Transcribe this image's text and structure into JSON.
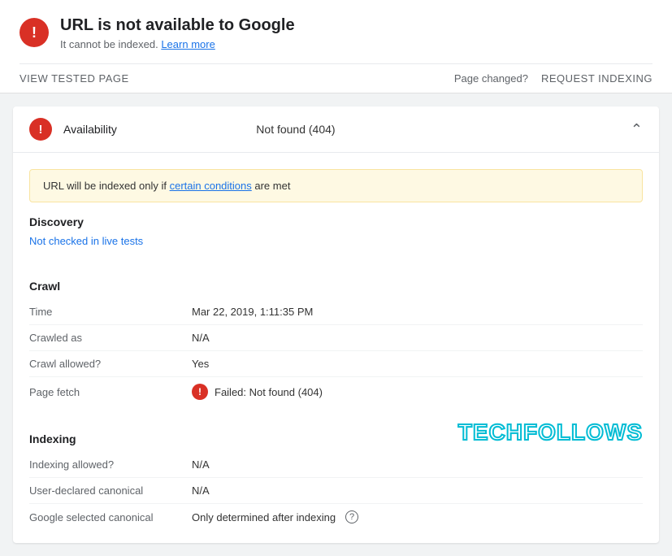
{
  "header": {
    "title": "URL is not available to Google",
    "subtitle": "It cannot be indexed.",
    "learn_more_label": "Learn more",
    "view_tested_page_label": "VIEW TESTED PAGE",
    "page_changed_label": "Page changed?",
    "request_indexing_label": "REQUEST INDEXING"
  },
  "availability": {
    "label": "Availability",
    "status": "Not found (404)",
    "icon": "!"
  },
  "warning": {
    "text": "URL will be indexed only if ",
    "link_text": "certain conditions",
    "text2": " are met"
  },
  "discovery": {
    "section_title": "Discovery",
    "not_checked_label": "Not checked in live tests"
  },
  "crawl": {
    "section_title": "Crawl",
    "rows": [
      {
        "label": "Time",
        "value": "Mar 22, 2019, 1:11:35 PM",
        "has_error": false
      },
      {
        "label": "Crawled as",
        "value": "N/A",
        "has_error": false
      },
      {
        "label": "Crawl allowed?",
        "value": "Yes",
        "has_error": false
      },
      {
        "label": "Page fetch",
        "value": "Failed: Not found (404)",
        "has_error": true
      }
    ]
  },
  "indexing": {
    "section_title": "Indexing",
    "rows": [
      {
        "label": "Indexing allowed?",
        "value": "N/A",
        "has_error": false
      },
      {
        "label": "User-declared canonical",
        "value": "N/A",
        "has_error": false
      },
      {
        "label": "Google selected canonical",
        "value": "Only determined after indexing",
        "has_error": false,
        "has_info": true
      }
    ]
  },
  "watermark": {
    "text": "TECHFOLLOWS"
  }
}
